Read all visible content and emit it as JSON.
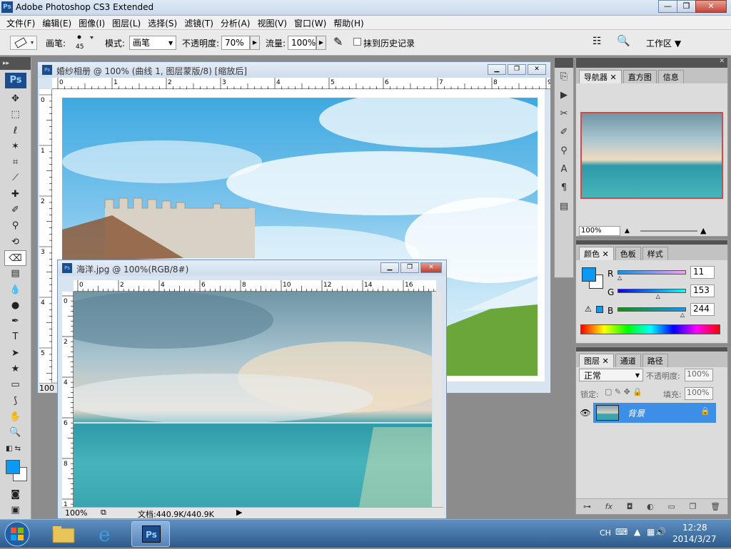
{
  "app": {
    "title": "Adobe Photoshop CS3 Extended"
  },
  "window_buttons": {
    "minimize": "—",
    "restore": "❐",
    "close": "✕"
  },
  "menu": [
    "文件(F)",
    "编辑(E)",
    "图像(I)",
    "图层(L)",
    "选择(S)",
    "滤镜(T)",
    "分析(A)",
    "视图(V)",
    "窗口(W)",
    "帮助(H)"
  ],
  "options": {
    "brush_label": "画笔:",
    "brush_size": "45",
    "mode_label": "模式:",
    "mode_value": "画笔",
    "opacity_label": "不透明度:",
    "opacity_value": "70%",
    "flow_label": "流量:",
    "flow_value": "100%",
    "erase_history_label": "抹到历史记录",
    "workspace_label": "工作区"
  },
  "toolbox": {
    "logo": "Ps"
  },
  "doc1": {
    "title": "婚纱相册 @ 100% (曲线 1, 图层蒙版/8) [缩放后]",
    "hruler": [
      "0",
      "1",
      "2",
      "3",
      "4",
      "5",
      "6",
      "7",
      "8",
      "9"
    ],
    "vruler": [
      "0",
      "1",
      "2",
      "3",
      "4",
      "5"
    ],
    "zoom": "100"
  },
  "doc2": {
    "title": "海洋.jpg @ 100%(RGB/8#)",
    "hruler": [
      "0",
      "2",
      "4",
      "6",
      "8",
      "10",
      "12",
      "14",
      "16"
    ],
    "vruler": [
      "0",
      "2",
      "4",
      "6",
      "8",
      "1"
    ],
    "zoom": "100%",
    "doc_size": "文档:440.9K/440.9K"
  },
  "navigator": {
    "tabs": [
      "导航器",
      "直方图",
      "信息"
    ],
    "zoom": "100%"
  },
  "color_panel": {
    "tabs": [
      "颜色",
      "色板",
      "样式"
    ],
    "r_label": "R",
    "r_value": "11",
    "g_label": "G",
    "g_value": "153",
    "b_label": "B",
    "b_value": "244",
    "r": 11,
    "g": 153,
    "b": 244,
    "fg_color": "#0b99f4"
  },
  "layers_panel": {
    "tabs": [
      "图层",
      "通道",
      "路径"
    ],
    "blend_mode": "正常",
    "opacity_label": "不透明度:",
    "opacity_value": "100%",
    "lock_label": "锁定:",
    "fill_label": "填充:",
    "fill_value": "100%",
    "layers": [
      {
        "name": "背景",
        "visible": true,
        "locked": true
      }
    ],
    "footer_icons": [
      "link-icon",
      "fx-icon",
      "mask-icon",
      "adjustment-icon",
      "folder-icon",
      "new-layer-icon",
      "trash-icon"
    ]
  },
  "taskbar": {
    "lang": "CH",
    "time": "12:28",
    "date": "2014/3/27"
  }
}
